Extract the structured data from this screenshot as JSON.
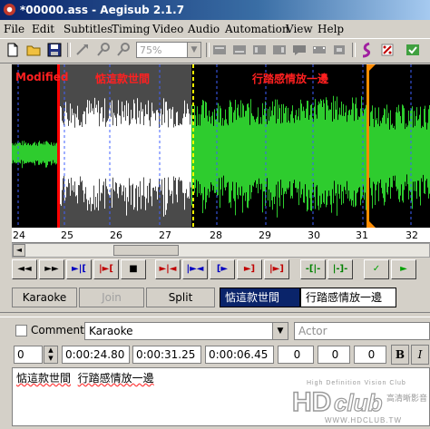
{
  "window": {
    "title": "*00000.ass - Aegisub 2.1.7"
  },
  "menu": [
    "File",
    "Edit",
    "Subtitles",
    "Timing",
    "Video",
    "Audio",
    "Automation",
    "View",
    "Help"
  ],
  "toolbar": {
    "zoom_value": "75%"
  },
  "audio": {
    "labels": {
      "modified": "Modified",
      "line1": "惦這款世間",
      "line2": "行踏感情放一邊"
    },
    "ruler_ticks": [
      "24",
      "25",
      "26",
      "27",
      "28",
      "29",
      "30",
      "31",
      "32"
    ],
    "buttons": [
      "◄◄",
      "►►",
      "►|[",
      "|►[",
      "■",
      "►|◄",
      "|►◄",
      "[►",
      "►]",
      "|►]",
      "-[|-",
      "|-]-",
      "✓",
      "►"
    ]
  },
  "karaoke": {
    "karaoke_label": "Karaoke",
    "join_label": "Join",
    "split_label": "Split",
    "syllables": [
      "惦這款世間",
      "行踏感情放一邊"
    ]
  },
  "editor": {
    "comment_label": "Comment",
    "style_value": "Karaoke",
    "actor_placeholder": "Actor",
    "layer_value": "0",
    "start_time": "0:00:24.80",
    "end_time": "0:00:31.25",
    "duration": "0:00:06.45",
    "margin_l": "0",
    "margin_r": "0",
    "margin_v": "0",
    "bold_label": "B",
    "italic_label": "I",
    "text_syllables": [
      "惦這款世間",
      "行踏感情放一邊"
    ]
  },
  "watermark": {
    "tagline": "High Definition Vision Club",
    "logo_text": "HDclub",
    "chinese": "高清晰影音",
    "url": "WWW.HDCLUB.TW"
  },
  "colors": {
    "waveform_green": "#2ecc2e",
    "waveform_selected": "#ffffff",
    "selection_bg": "#4a4a4a",
    "label_red": "#ff2020",
    "boundary_orange": "#ff8c00"
  }
}
